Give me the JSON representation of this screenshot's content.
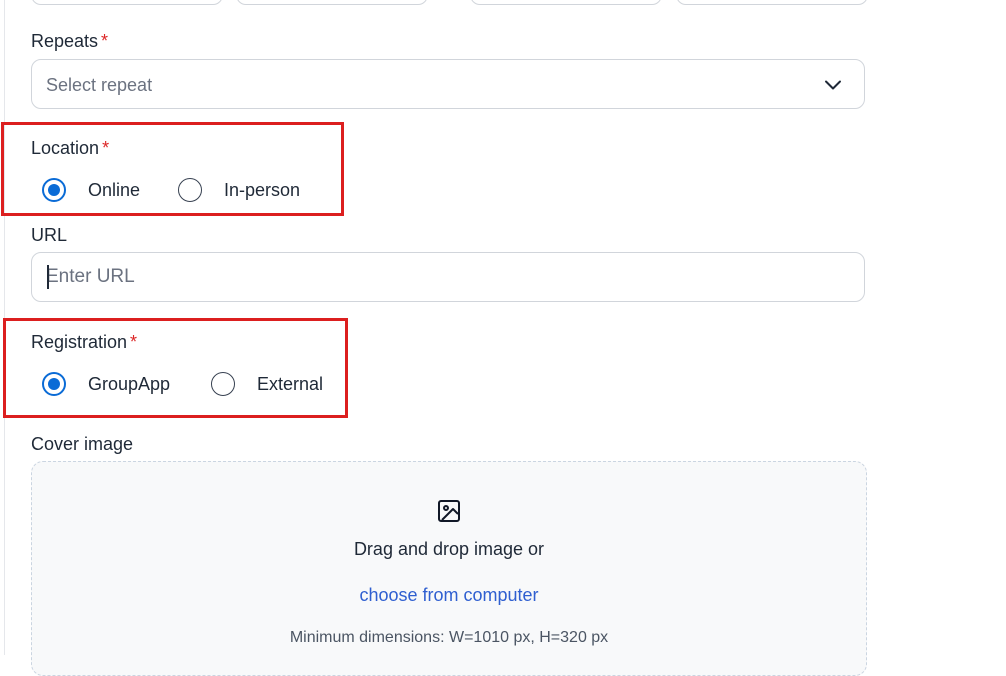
{
  "form": {
    "repeats": {
      "label": "Repeats",
      "required_mark": "*",
      "placeholder": "Select repeat"
    },
    "location": {
      "label": "Location",
      "required_mark": "*",
      "options": [
        {
          "label": "Online",
          "selected": true
        },
        {
          "label": "In-person",
          "selected": false
        }
      ]
    },
    "url": {
      "label": "URL",
      "placeholder": "Enter URL",
      "value": ""
    },
    "registration": {
      "label": "Registration",
      "required_mark": "*",
      "options": [
        {
          "label": "GroupApp",
          "selected": true
        },
        {
          "label": "External",
          "selected": false
        }
      ]
    },
    "cover_image": {
      "label": "Cover image",
      "icon": "image-icon",
      "drag_text": "Drag and drop image or",
      "choose_link": "choose from computer",
      "hint": "Minimum dimensions: W=1010 px, H=320 px"
    }
  },
  "colors": {
    "accent": "#0a6bd6",
    "required": "#dc2626",
    "highlight": "#dc1f1f",
    "link": "#2f5fd0"
  }
}
